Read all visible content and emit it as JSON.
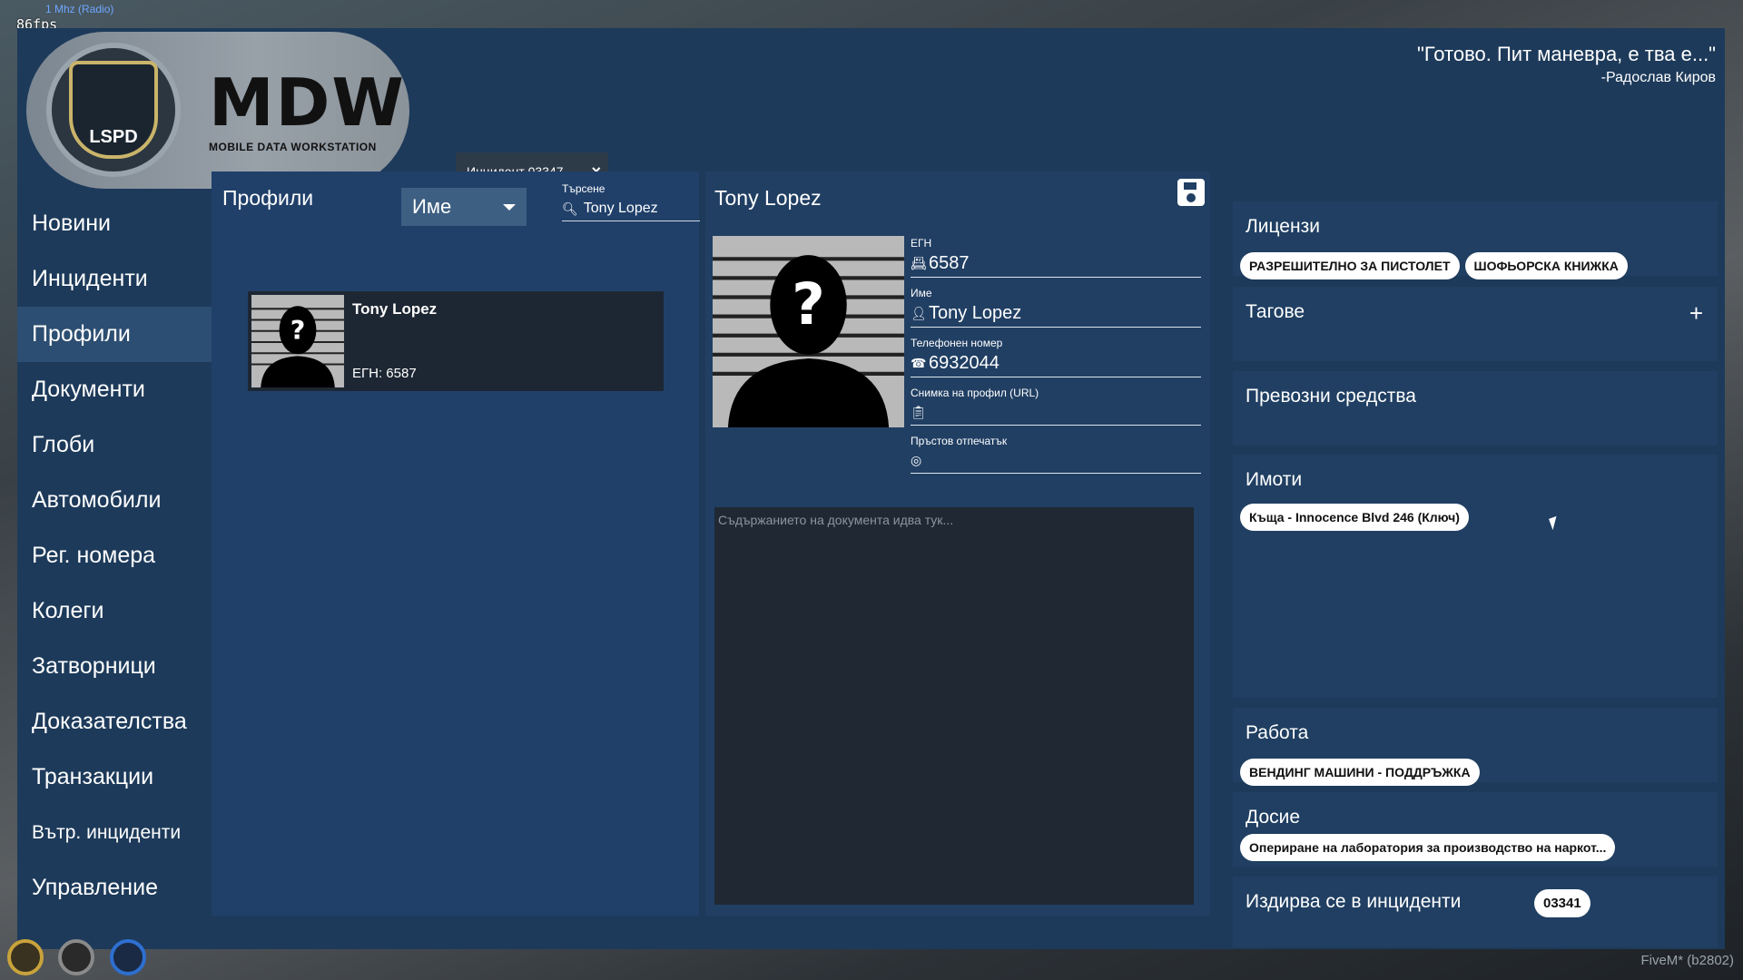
{
  "hud": {
    "fps": "86fps",
    "radio": "1 Mhz (Radio)",
    "fivem": "FiveM* (b2802)"
  },
  "header": {
    "logo_title": "MDW",
    "logo_subtitle": "MOBILE DATA WORKSTATION",
    "badge_text": "LSPD",
    "tab_label": "Инцидент 03347",
    "tab_close": "×",
    "quote": "\"Готово. Пит маневра, е тва е...\"",
    "quote_author": "-Радослав Киров"
  },
  "sidebar": {
    "items": [
      {
        "label": "Новини"
      },
      {
        "label": "Инциденти"
      },
      {
        "label": "Профили"
      },
      {
        "label": "Документи"
      },
      {
        "label": "Глоби"
      },
      {
        "label": "Автомобили"
      },
      {
        "label": "Рег. номера"
      },
      {
        "label": "Колеги"
      },
      {
        "label": "Затворници"
      },
      {
        "label": "Доказателства"
      },
      {
        "label": "Транзакции"
      },
      {
        "label": "Вътр. инциденти"
      },
      {
        "label": "Управление"
      }
    ]
  },
  "profiles": {
    "title": "Профили",
    "filter_value": "Име",
    "search_label": "Търсене",
    "search_value": "Tony Lopez",
    "results": [
      {
        "name": "Tony Lopez",
        "egn": "ЕГН: 6587"
      }
    ]
  },
  "detail": {
    "name": "Tony Lopez",
    "fields": {
      "egn_label": "ЕГН",
      "egn_value": "6587",
      "name_label": "Име",
      "name_value": "Tony Lopez",
      "phone_label": "Телефонен номер",
      "phone_value": "6932044",
      "photo_label": "Снимка на профил (URL)",
      "photo_value": "",
      "fingerprint_label": "Пръстов отпечатък",
      "fingerprint_value": ""
    },
    "doc_placeholder": "Съдържанието на документа идва тук..."
  },
  "right": {
    "licenses_title": "Лицензи",
    "licenses": [
      "РАЗРЕШИТЕЛНО ЗА ПИСТОЛЕТ",
      "ШОФЬОРСКА КНИЖКА"
    ],
    "tags_title": "Тагове",
    "tags_add": "+",
    "vehicles_title": "Превозни средства",
    "properties_title": "Имоти",
    "properties": [
      "Къща - Innocence Blvd 246 (Ключ)"
    ],
    "work_title": "Работа",
    "work": [
      "ВЕНДИНГ МАШИНИ - ПОДДРЪЖКА"
    ],
    "record_title": "Досие",
    "record": [
      "Опериране на лаборатория за производство на наркот..."
    ],
    "wanted_title": "Издирва се в инциденти",
    "wanted_incident": "03341"
  },
  "icons": [
    "search-icon",
    "close-icon",
    "save-icon",
    "id-card-icon",
    "person-icon",
    "phone-icon",
    "clipboard-icon",
    "fingerprint-icon",
    "plus-icon",
    "microphone-icon",
    "armor-icon",
    "water-icon"
  ]
}
